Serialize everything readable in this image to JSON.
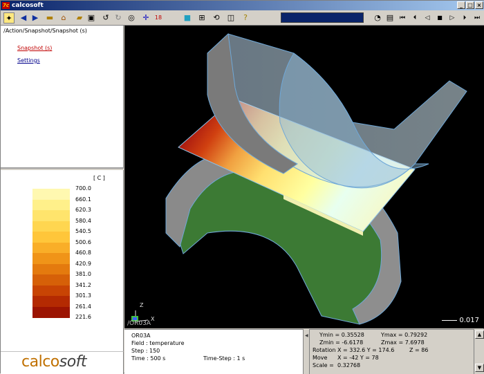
{
  "window": {
    "title": "calcosoft",
    "app_icon": "7c",
    "controls": [
      "_",
      "□",
      "×"
    ]
  },
  "toolbar": {
    "icons": [
      "select-icon",
      "back-arrow-icon",
      "forward-arrow-icon",
      "open-folder-icon",
      "home-icon",
      "open-file-icon",
      "save-icon",
      "undo-icon",
      "redo-icon",
      "target-icon",
      "crosshair-icon",
      "histogram-icon",
      "palette-icon",
      "grid-icon",
      "rotate-icon",
      "split-view-icon",
      "help-icon"
    ],
    "field_value": "",
    "playback_icons": [
      "timer-icon",
      "film-icon",
      "first-frame-icon",
      "prev-step-icon",
      "rewind-icon",
      "stop-icon",
      "play-icon",
      "next-step-icon",
      "last-frame-icon"
    ]
  },
  "nav": {
    "breadcrumb": "/Action/Snapshot/Snapshot (s)",
    "links": [
      {
        "label": "Snapshot (s)",
        "active": true
      },
      {
        "label": "Settings",
        "active": false
      }
    ]
  },
  "legend": {
    "unit": "[ C ]",
    "levels": [
      {
        "value": "700.0",
        "color": "#fff8b0"
      },
      {
        "value": "660.1",
        "color": "#fff08a"
      },
      {
        "value": "620.3",
        "color": "#ffe46c"
      },
      {
        "value": "580.4",
        "color": "#ffd650"
      },
      {
        "value": "540.5",
        "color": "#ffc63a"
      },
      {
        "value": "500.6",
        "color": "#f9ae28"
      },
      {
        "value": "460.8",
        "color": "#f09418"
      },
      {
        "value": "420.9",
        "color": "#e47a0e"
      },
      {
        "value": "381.0",
        "color": "#d66008"
      },
      {
        "value": "341.2",
        "color": "#c84404"
      },
      {
        "value": "301.3",
        "color": "#b42a02"
      },
      {
        "value": "261.4",
        "color": "#9c1402"
      },
      {
        "value": "221.6",
        "color": "#7c0402"
      }
    ]
  },
  "logo": {
    "part1": "calco",
    "part2": "soft"
  },
  "view": {
    "label": "/OR03A",
    "axis_z": "Z",
    "axis_x": "X",
    "scale": "0.017"
  },
  "info": {
    "name": "OR03A",
    "field": "Field :  temperature",
    "step": "Step : 150",
    "time": "Time : 500 s",
    "time_step": "Time-Step : 1 s"
  },
  "stats": {
    "ymin": "Ymin = 0.35528",
    "ymax": "Ymax = 0.79292",
    "zmin": "Zmin = -6.6178",
    "zmax": "Zmax = 7.6978",
    "rotation_label": "Rotation",
    "rotation": "X = 332.6  Y = 174.6",
    "rotation_z": "Z = 86",
    "move_label": "Move",
    "move": "X = -42     Y = 78",
    "scale_label": "Scale =",
    "scale": "0.32768"
  }
}
